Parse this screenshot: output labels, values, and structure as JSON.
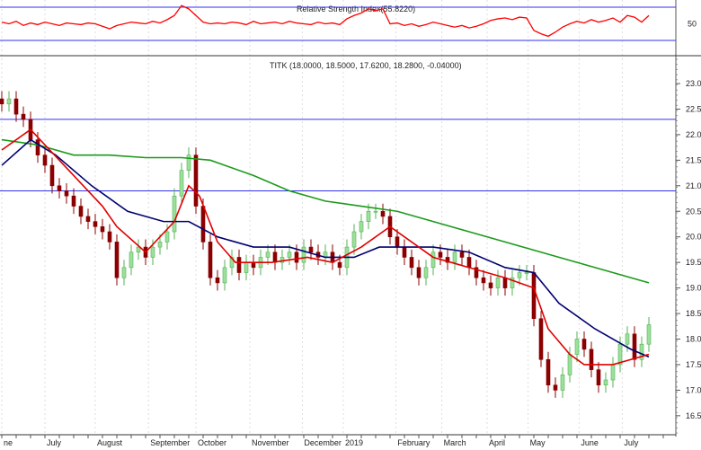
{
  "chart_data": {
    "type": "candlestick",
    "ticker_label": "TITK (18.0000, 18.5000, 17.6200, 18.2800, -0.04000)",
    "rsi": {
      "title": "Relative Strength Index(55.8220)",
      "levels": [
        70,
        30
      ],
      "tick_labels": [
        "50"
      ],
      "ylim": [
        22,
        78
      ],
      "values": [
        52,
        50,
        53,
        48,
        51,
        49,
        52,
        50,
        48,
        51,
        50,
        49,
        51,
        50,
        47,
        44,
        48,
        50,
        52,
        51,
        50,
        53,
        51,
        55,
        60,
        72,
        68,
        60,
        52,
        50,
        51,
        50,
        52,
        51,
        49,
        53,
        50,
        51,
        52,
        50,
        53,
        51,
        50,
        49,
        52,
        50,
        51,
        49,
        56,
        60,
        63,
        68,
        66,
        68,
        50,
        51,
        48,
        50,
        47,
        49,
        52,
        50,
        48,
        46,
        48,
        45,
        47,
        50,
        54,
        56,
        57,
        55,
        58,
        57,
        42,
        38,
        35,
        40,
        46,
        50,
        53,
        51,
        55,
        52,
        54,
        57,
        52,
        60,
        58,
        52,
        60
      ]
    },
    "price": {
      "ylim": [
        16.2,
        23.3
      ],
      "y_ticks": [
        "23.0",
        "22.5",
        "22.0",
        "21.5",
        "21.0",
        "20.5",
        "20.0",
        "19.5",
        "19.0",
        "18.5",
        "18.0",
        "17.5",
        "17.0",
        "16.5"
      ],
      "horizontal_lines": [
        22.3,
        20.9
      ],
      "closes": [
        22.6,
        22.7,
        22.4,
        22.3,
        21.9,
        21.6,
        21.4,
        21.0,
        20.9,
        20.8,
        20.6,
        20.4,
        20.3,
        20.2,
        20.1,
        19.9,
        19.2,
        19.4,
        19.7,
        19.8,
        19.6,
        19.8,
        19.9,
        20.1,
        20.8,
        21.3,
        21.6,
        20.6,
        19.9,
        19.2,
        19.1,
        19.4,
        19.6,
        19.3,
        19.5,
        19.4,
        19.6,
        19.7,
        19.5,
        19.6,
        19.7,
        19.5,
        19.8,
        19.7,
        19.6,
        19.7,
        19.5,
        19.4,
        19.8,
        20.1,
        20.3,
        20.5,
        20.5,
        20.4,
        20.0,
        19.8,
        19.6,
        19.4,
        19.2,
        19.4,
        19.7,
        19.6,
        19.5,
        19.7,
        19.6,
        19.4,
        19.2,
        19.1,
        19.0,
        19.2,
        19.0,
        19.2,
        19.3,
        19.3,
        18.4,
        17.6,
        17.1,
        17.0,
        17.3,
        17.7,
        18.0,
        17.8,
        17.4,
        17.1,
        17.2,
        17.5,
        17.9,
        18.1,
        17.6,
        17.9,
        18.28
      ],
      "moving_averages": [
        {
          "name": "long",
          "color": "#1a9a1a",
          "points": [
            [
              0,
              21.9
            ],
            [
              5,
              21.8
            ],
            [
              10,
              21.6
            ],
            [
              15,
              21.6
            ],
            [
              20,
              21.55
            ],
            [
              25,
              21.55
            ],
            [
              29,
              21.5
            ],
            [
              35,
              21.2
            ],
            [
              40,
              20.9
            ],
            [
              45,
              20.7
            ],
            [
              50,
              20.6
            ],
            [
              55,
              20.5
            ],
            [
              60,
              20.3
            ],
            [
              65,
              20.1
            ],
            [
              70,
              19.9
            ],
            [
              75,
              19.7
            ],
            [
              80,
              19.5
            ],
            [
              85,
              19.3
            ],
            [
              90,
              19.1
            ]
          ]
        },
        {
          "name": "medium",
          "color": "#000070",
          "points": [
            [
              0,
              21.4
            ],
            [
              4,
              21.9
            ],
            [
              7.5,
              21.6
            ],
            [
              12.5,
              21.0
            ],
            [
              17.5,
              20.5
            ],
            [
              22.5,
              20.3
            ],
            [
              26,
              20.3
            ],
            [
              30,
              20.0
            ],
            [
              35,
              19.8
            ],
            [
              40,
              19.8
            ],
            [
              45,
              19.6
            ],
            [
              49,
              19.6
            ],
            [
              52.5,
              19.8
            ],
            [
              56,
              19.8
            ],
            [
              60,
              19.8
            ],
            [
              65,
              19.7
            ],
            [
              70,
              19.4
            ],
            [
              74,
              19.3
            ],
            [
              77.5,
              18.7
            ],
            [
              82.5,
              18.2
            ],
            [
              87.5,
              17.8
            ],
            [
              90,
              17.65
            ]
          ]
        },
        {
          "name": "short",
          "color": "#e00000",
          "points": [
            [
              0,
              21.7
            ],
            [
              4,
              22.1
            ],
            [
              6,
              21.8
            ],
            [
              10,
              21.2
            ],
            [
              14,
              20.6
            ],
            [
              16,
              20.2
            ],
            [
              20,
              19.7
            ],
            [
              24,
              20.3
            ],
            [
              26,
              21.0
            ],
            [
              27.5,
              20.8
            ],
            [
              30,
              19.9
            ],
            [
              32.5,
              19.5
            ],
            [
              37.5,
              19.5
            ],
            [
              42.5,
              19.6
            ],
            [
              46,
              19.5
            ],
            [
              50,
              19.8
            ],
            [
              54,
              20.2
            ],
            [
              56,
              20.0
            ],
            [
              60,
              19.6
            ],
            [
              65,
              19.4
            ],
            [
              70,
              19.2
            ],
            [
              74,
              19.0
            ],
            [
              76,
              18.2
            ],
            [
              79,
              17.7
            ],
            [
              81,
              17.5
            ],
            [
              85,
              17.5
            ],
            [
              87.5,
              17.6
            ],
            [
              90,
              17.7
            ]
          ]
        }
      ]
    },
    "x_labels": [
      {
        "label": "ne",
        "index": 0
      },
      {
        "label": "July",
        "index": 6
      },
      {
        "label": "August",
        "index": 13
      },
      {
        "label": "September",
        "index": 20.4
      },
      {
        "label": "October",
        "index": 27
      },
      {
        "label": "November",
        "index": 34.5
      },
      {
        "label": "December",
        "index": 41.8
      },
      {
        "label": "2019",
        "index": 47.5
      },
      {
        "label": "February",
        "index": 54.8
      },
      {
        "label": "March",
        "index": 61.2
      },
      {
        "label": "April",
        "index": 67.5
      },
      {
        "label": "May",
        "index": 73.2
      },
      {
        "label": "June",
        "index": 80.3
      },
      {
        "label": "July",
        "index": 86.3
      }
    ],
    "colors": {
      "up": "#9be09b",
      "up_border": "#55b055",
      "down": "#8b0000",
      "level_line": "#3030f0",
      "rsi": "#ff0000"
    }
  }
}
